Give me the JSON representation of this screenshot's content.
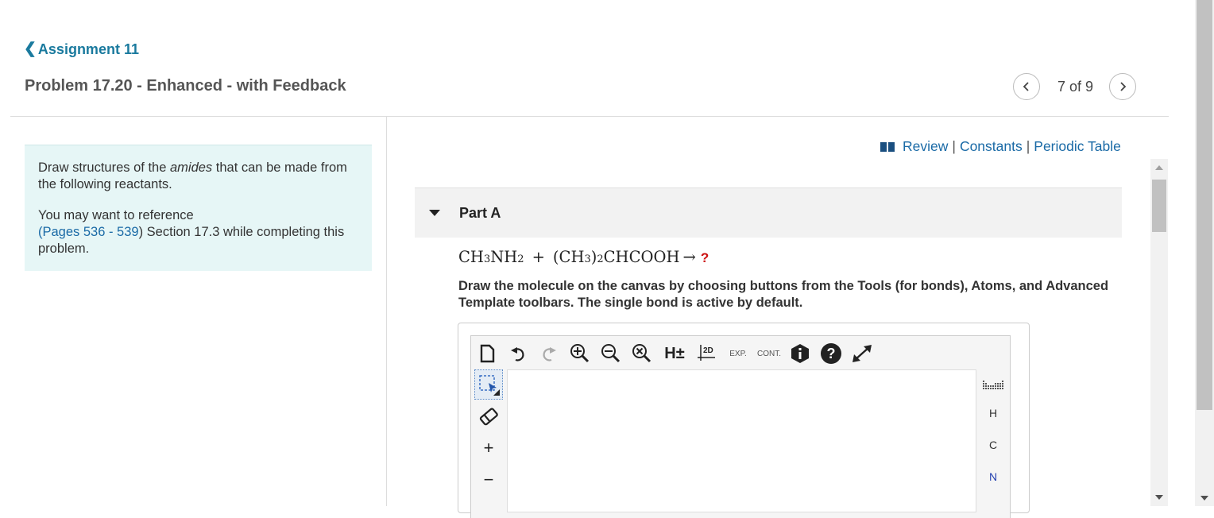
{
  "header": {
    "back_link": "Assignment 11",
    "problem_title": "Problem 17.20 - Enhanced - with Feedback",
    "pager": {
      "prev_icon": "chevron-left-icon",
      "count": "7 of 9",
      "next_icon": "chevron-right-icon"
    }
  },
  "intro": {
    "line1_before": "Draw structures of the ",
    "line1_em": "amides",
    "line1_after": " that can be made from the following reactants.",
    "ref_before": "You may want to reference",
    "ref_open": "(",
    "ref_link": "Pages 536 - 539",
    "ref_after": ") Section 17.3 while completing this problem."
  },
  "resources": {
    "icon": "book-icon",
    "review": "Review",
    "sep1": "|",
    "constants": "Constants",
    "sep2": "|",
    "periodic": "Periodic Table"
  },
  "part": {
    "label": "Part A",
    "equation": {
      "r1a": "CH",
      "r1b": "3",
      "r1c": "NH",
      "r1d": "2",
      "plus": "+",
      "r2a": "(CH",
      "r2b": "3",
      "r2c": ")",
      "r2d": "2",
      "r2e": "CHCOOH",
      "arrow": "→",
      "unknown": "?"
    },
    "instructions": "Draw the molecule on the canvas by choosing buttons from the Tools (for bonds), Atoms, and Advanced Template toolbars. The single bond is active by default."
  },
  "editor": {
    "top_tools": {
      "h_label": "H±",
      "twod_label": "2D",
      "exp_label": "EXP.",
      "cont_label": "CONT."
    },
    "left_tools": {
      "add_label": "+",
      "sub_label": "−"
    },
    "atoms": [
      "H",
      "C",
      "N"
    ]
  },
  "colors": {
    "link": "#1a6aa6",
    "back_link": "#1a7a9e",
    "intro_bg": "#e6f6f6",
    "unknown": "#cc1111"
  }
}
